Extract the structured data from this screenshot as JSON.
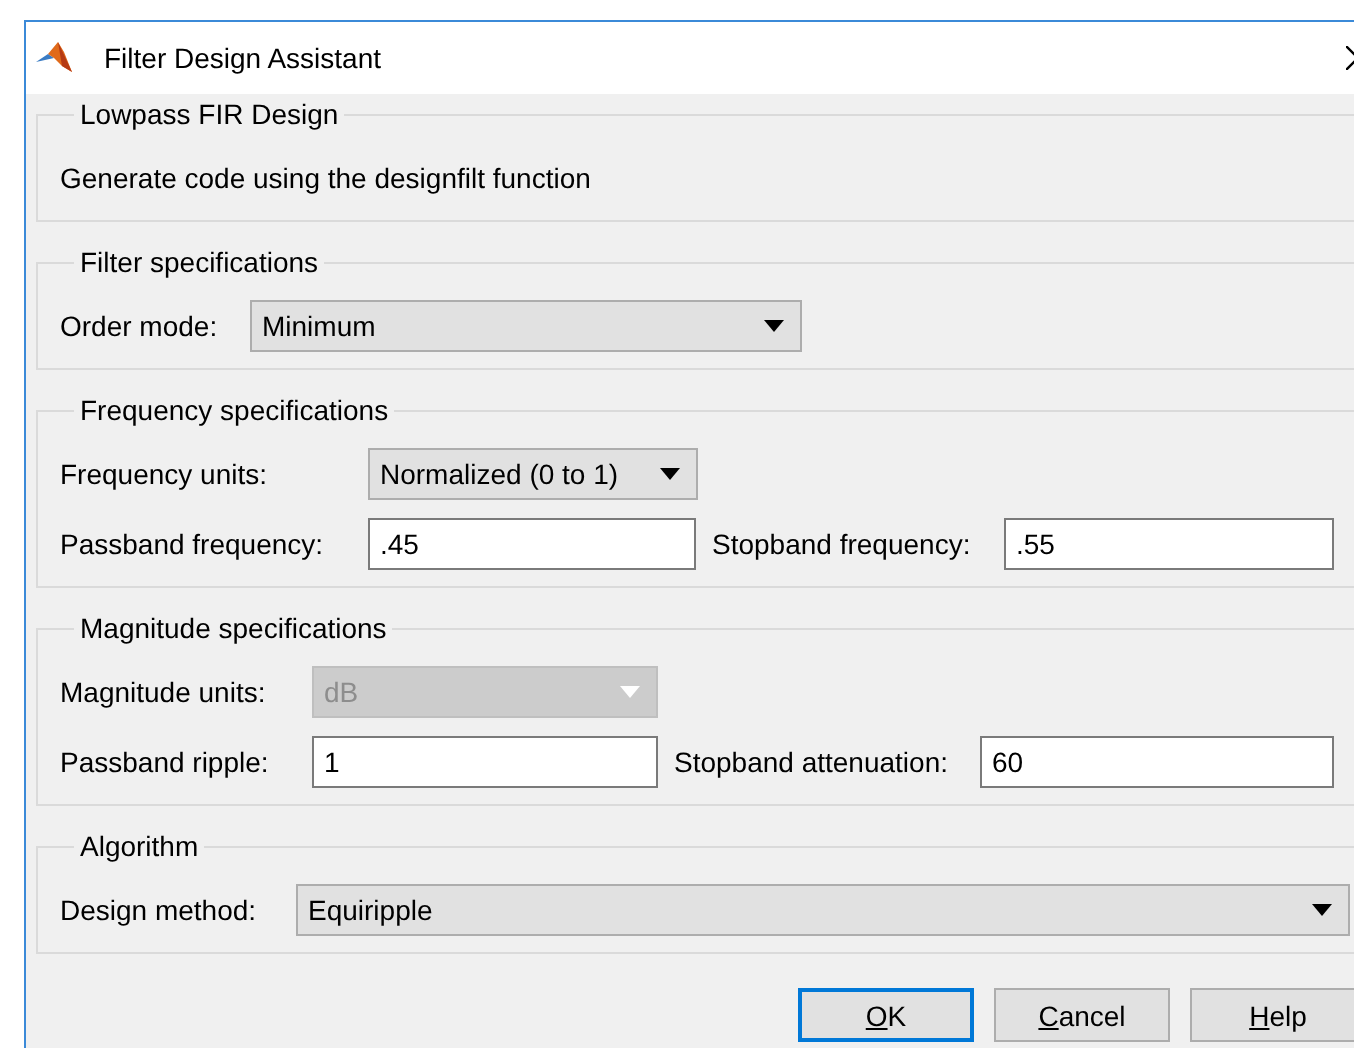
{
  "window": {
    "title": "Filter Design Assistant"
  },
  "sections": [
    {
      "title": "Lowpass FIR Design",
      "rows": [
        [
          {
            "kind": "text",
            "text": "Generate code using the designfilt function"
          }
        ]
      ]
    },
    {
      "title": "Filter specifications",
      "rows": [
        [
          {
            "kind": "dropdown",
            "label": "Order mode:",
            "value": "Minimum",
            "disabled": false
          }
        ]
      ]
    },
    {
      "title": "Frequency specifications",
      "rows": [
        [
          {
            "kind": "dropdown",
            "label": "Frequency units:",
            "value": "Normalized (0 to 1)",
            "disabled": false
          }
        ],
        [
          {
            "kind": "field",
            "label": "Passband frequency:",
            "value": ".45"
          },
          {
            "kind": "field",
            "label": "Stopband frequency:",
            "value": ".55"
          }
        ]
      ]
    },
    {
      "title": "Magnitude specifications",
      "rows": [
        [
          {
            "kind": "dropdown",
            "label": "Magnitude units:",
            "value": "dB",
            "disabled": true
          }
        ],
        [
          {
            "kind": "field",
            "label": "Passband ripple:",
            "value": "1"
          },
          {
            "kind": "field",
            "label": "Stopband attenuation:",
            "value": "60"
          }
        ]
      ]
    },
    {
      "title": "Algorithm",
      "rows": [
        [
          {
            "kind": "dropdown",
            "label": "Design method:",
            "value": "Equiripple",
            "disabled": false
          }
        ]
      ]
    }
  ],
  "buttons": [
    {
      "label": "OK",
      "default": true
    },
    {
      "label": "Cancel",
      "default": false
    },
    {
      "label": "Help",
      "default": false
    }
  ]
}
